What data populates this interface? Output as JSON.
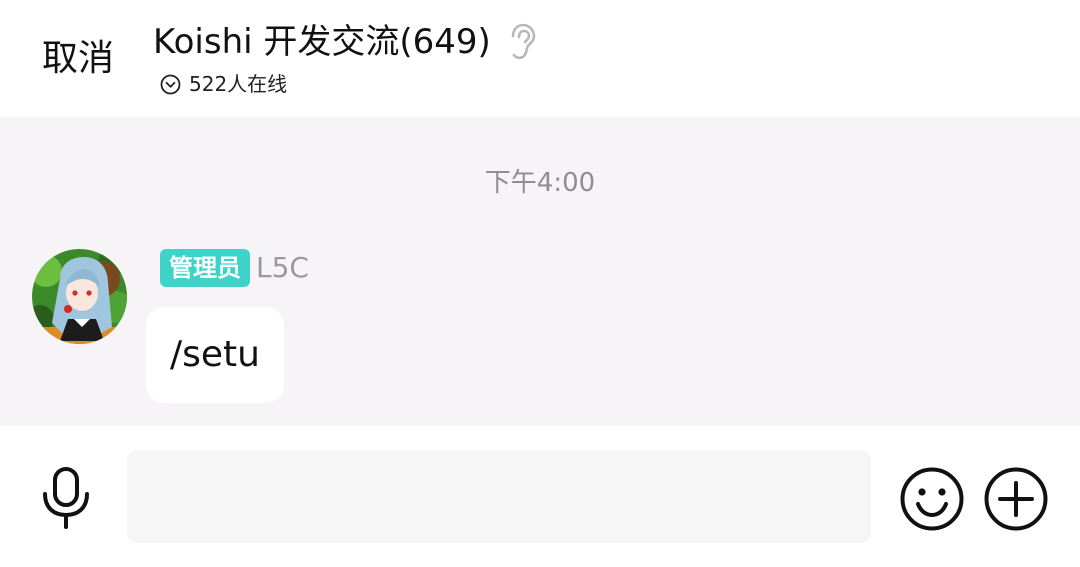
{
  "header": {
    "cancel_label": "取消",
    "title": "Koishi 开发交流(649)",
    "online_status": "522人在线"
  },
  "icons": {
    "ear": "ear-icon",
    "chevron": "chevron-down-circle-icon",
    "mic": "microphone-icon",
    "emoji": "smiley-icon",
    "plus": "plus-circle-icon"
  },
  "chat": {
    "time_label": "下午4:00",
    "messages": [
      {
        "role_badge": "管理员",
        "sender": "L5C",
        "text": "/setu"
      }
    ]
  },
  "input": {
    "value": "",
    "placeholder": ""
  },
  "colors": {
    "chat_background": "#f6f4f6",
    "badge_background": "#3ed3c8",
    "input_background": "#f6f6f6"
  }
}
